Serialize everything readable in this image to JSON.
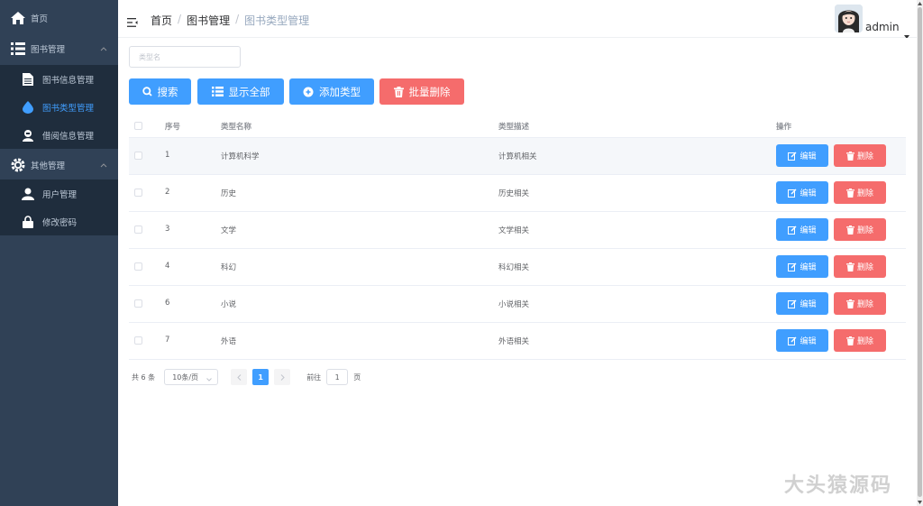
{
  "sidebar": {
    "home": "首页",
    "book_menu": "图书管理",
    "book_items": [
      "图书信息管理",
      "图书类型管理",
      "借阅信息管理"
    ],
    "other_menu": "其他管理",
    "other_items": [
      "用户管理",
      "修改密码"
    ]
  },
  "header": {
    "breadcrumb": [
      "首页",
      "图书管理",
      "图书类型管理"
    ],
    "user": "admin"
  },
  "toolbar": {
    "search_placeholder": "类型名",
    "search": "搜索",
    "show_all": "显示全部",
    "add": "添加类型",
    "batch_delete": "批量删除"
  },
  "table": {
    "columns": [
      "序号",
      "类型名称",
      "类型描述",
      "操作"
    ],
    "edit_label": "编辑",
    "delete_label": "删除",
    "rows": [
      {
        "id": "1",
        "name": "计算机科学",
        "desc": "计算机相关"
      },
      {
        "id": "2",
        "name": "历史",
        "desc": "历史相关"
      },
      {
        "id": "3",
        "name": "文学",
        "desc": "文学相关"
      },
      {
        "id": "4",
        "name": "科幻",
        "desc": "科幻相关"
      },
      {
        "id": "6",
        "name": "小说",
        "desc": "小说相关"
      },
      {
        "id": "7",
        "name": "外语",
        "desc": "外语相关"
      }
    ]
  },
  "pagination": {
    "total": "共 6 条",
    "page_size": "10条/页",
    "current": "1",
    "goto_prefix": "前往",
    "goto_value": "1",
    "goto_suffix": "页"
  },
  "watermark": "大头猿源码",
  "colors": {
    "sidebar_bg": "#304156",
    "submenu_bg": "#1f2d3d",
    "primary": "#409eff",
    "danger": "#f56c6c"
  }
}
